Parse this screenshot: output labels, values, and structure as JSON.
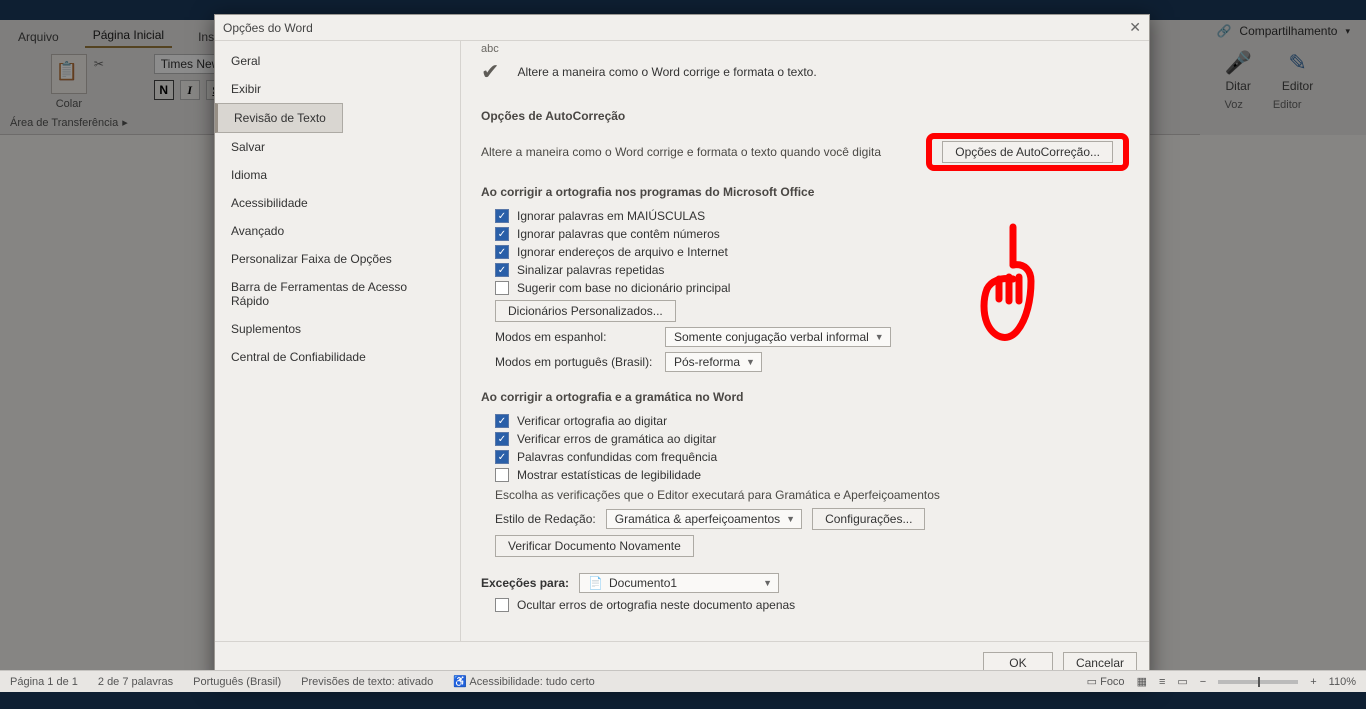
{
  "ribbon": {
    "tabs": {
      "file": "Arquivo",
      "home": "Página Inicial",
      "next": "Ins"
    },
    "clipboard": {
      "paste": "Colar",
      "group": "Área de Transferência"
    },
    "font": {
      "name": "Times New R",
      "bold": "N",
      "italic": "I",
      "under": "S"
    },
    "share": "Compartilhamento",
    "voice": {
      "dictate": "Ditar",
      "editor": "Editor",
      "voz": "Voz",
      "editor2": "Editor"
    }
  },
  "dialog": {
    "title": "Opções do Word",
    "sidebar": {
      "geral": "Geral",
      "exibir": "Exibir",
      "revisao": "Revisão de Texto",
      "salvar": "Salvar",
      "idioma": "Idioma",
      "acess": "Acessibilidade",
      "avanc": "Avançado",
      "faixa": "Personalizar Faixa de Opções",
      "barra": "Barra de Ferramentas de Acesso Rápido",
      "supl": "Suplementos",
      "central": "Central de Confiabilidade"
    },
    "header_line": "Altere a maneira como o Word corrige e formata o texto.",
    "sec_autoc": "Opções de AutoCorreção",
    "autoc_para": "Altere a maneira como o Word corrige e formata o texto quando você digita",
    "autoc_btn": "Opções de AutoCorreção...",
    "sec_office": "Ao corrigir a ortografia nos programas do Microsoft Office",
    "chk1": "Ignorar palavras em MAIÚSCULAS",
    "chk2": "Ignorar palavras que contêm números",
    "chk3": "Ignorar endereços de arquivo e Internet",
    "chk4": "Sinalizar palavras repetidas",
    "chk5": "Sugerir com base no dicionário principal",
    "dict_btn": "Dicionários Personalizados...",
    "span_lbl": "Modos em espanhol:",
    "span_val": "Somente conjugação verbal informal",
    "port_lbl": "Modos em português (Brasil):",
    "port_val": "Pós-reforma",
    "sec_word": "Ao corrigir a ortografia e a gramática no Word",
    "wchk1": "Verificar ortografia ao digitar",
    "wchk2": "Verificar erros de gramática ao digitar",
    "wchk3": "Palavras confundidas com frequência",
    "wchk4": "Mostrar estatísticas de legibilidade",
    "wpara": "Escolha as verificações que o Editor executará para Gramática e Aperfeiçoamentos",
    "estilo_lbl": "Estilo de Redação:",
    "estilo_val": "Gramática & aperfeiçoamentos",
    "config_btn": "Configurações...",
    "verif_btn": "Verificar Documento Novamente",
    "except_lbl": "Exceções para:",
    "except_val": "Documento1",
    "xchk1": "Ocultar erros de ortografia neste documento apenas",
    "ok": "OK",
    "cancel": "Cancelar"
  },
  "status": {
    "page": "Página 1 de 1",
    "words": "2 de 7 palavras",
    "lang": "Português (Brasil)",
    "predict": "Previsões de texto: ativado",
    "access": "Acessibilidade: tudo certo",
    "foco": "Foco",
    "zoom": "110%"
  }
}
